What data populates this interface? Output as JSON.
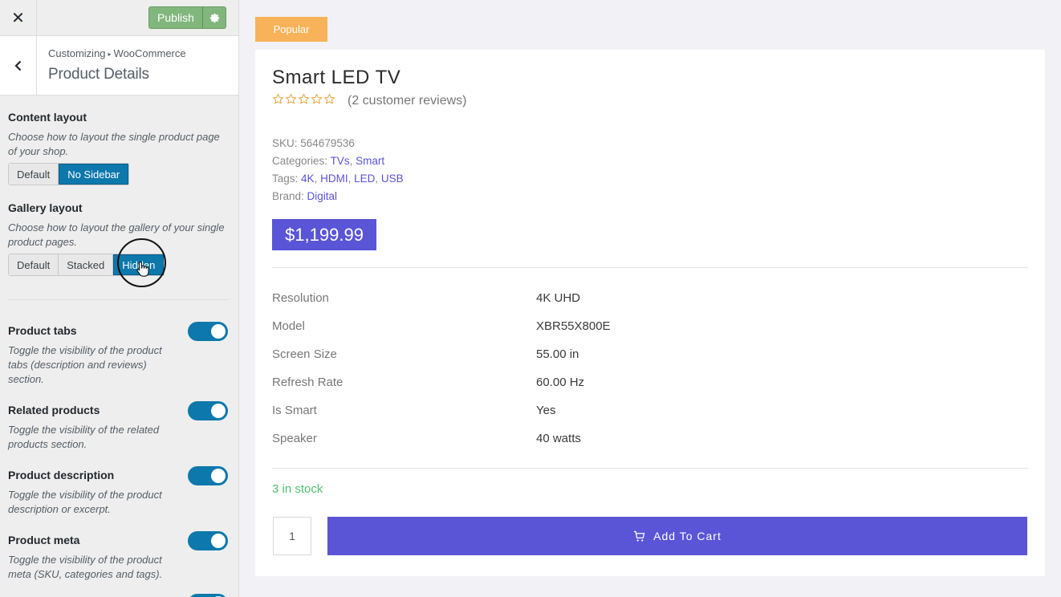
{
  "topbar": {
    "close_glyph": "✕",
    "publish_label": "Publish",
    "publish_settings_icon": "gear-icon"
  },
  "section": {
    "breadcrumb_root": "Customizing",
    "breadcrumb_sep": "▸",
    "breadcrumb_leaf": "WooCommerce",
    "title": "Product Details"
  },
  "content_layout": {
    "title": "Content layout",
    "desc": "Choose how to layout the single product page of your shop.",
    "options": [
      "Default",
      "No Sidebar"
    ],
    "selected": "No Sidebar"
  },
  "gallery_layout": {
    "title": "Gallery layout",
    "desc": "Choose how to layout the gallery of your single product pages.",
    "options": [
      "Default",
      "Stacked",
      "Hidden"
    ],
    "selected": "Hidden"
  },
  "toggles": [
    {
      "title": "Product tabs",
      "desc": "Toggle the visibility of the product tabs (description and reviews) section.",
      "on": true
    },
    {
      "title": "Related products",
      "desc": "Toggle the visibility of the related products section.",
      "on": true
    },
    {
      "title": "Product description",
      "desc": "Toggle the visibility of the product description or excerpt.",
      "on": true
    },
    {
      "title": "Product meta",
      "desc": "Toggle the visibility of the product meta (SKU, categories and tags).",
      "on": true
    }
  ],
  "product": {
    "badge": "Popular",
    "title": "Smart LED TV",
    "rating_stars_filled": 0,
    "rating_stars_total": 5,
    "reviews": "(2 customer reviews)",
    "sku_label": "SKU:",
    "sku": "564679536",
    "categories_label": "Categories:",
    "categories": [
      "TVs",
      "Smart"
    ],
    "tags_label": "Tags:",
    "tags": [
      "4K",
      "HDMI",
      "LED",
      "USB"
    ],
    "brand_label": "Brand:",
    "brand": "Digital",
    "price": "$1,199.99",
    "specs": [
      {
        "label": "Resolution",
        "value": "4K UHD"
      },
      {
        "label": "Model",
        "value": "XBR55X800E"
      },
      {
        "label": "Screen Size",
        "value": "55.00 in"
      },
      {
        "label": "Refresh Rate",
        "value": "60.00 Hz"
      },
      {
        "label": "Is Smart",
        "value": "Yes"
      },
      {
        "label": "Speaker",
        "value": "40 watts"
      }
    ],
    "stock": "3 in stock",
    "quantity": "1",
    "add_to_cart": "Add To Cart"
  },
  "colors": {
    "accent_blue": "#0d78ac",
    "publish_green": "#81b67c",
    "brand_purple": "#5a55d6",
    "badge_orange": "#f8b259",
    "stock_green": "#4fbf72",
    "star_gold": "#e0a33e"
  }
}
